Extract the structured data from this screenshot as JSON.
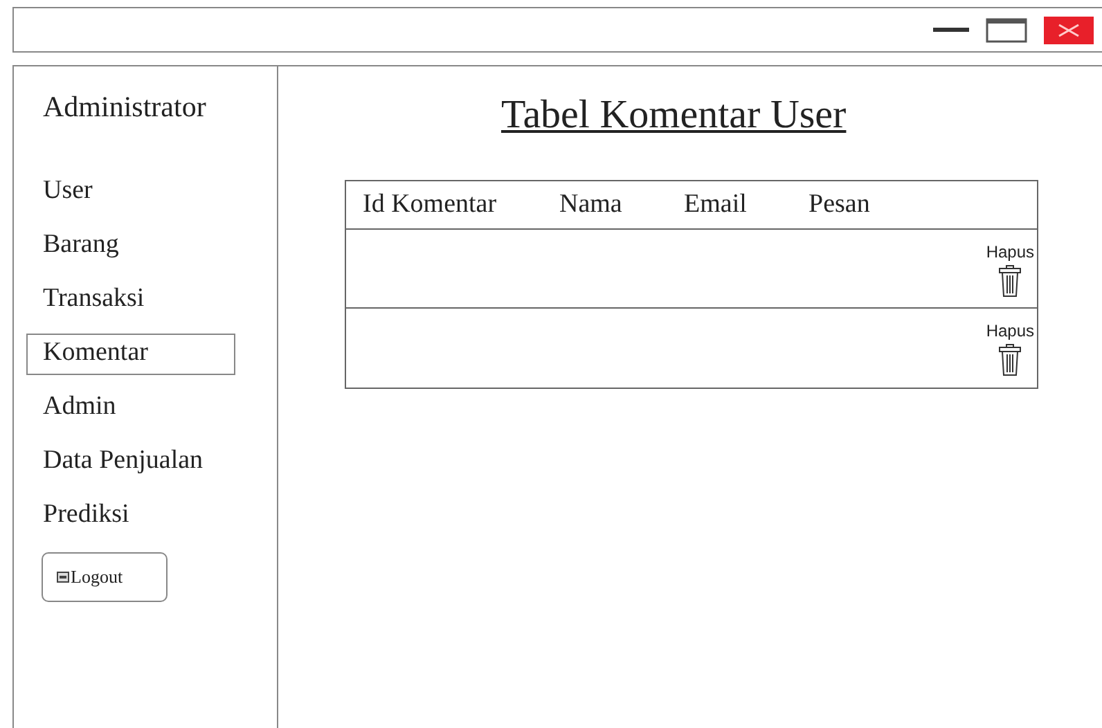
{
  "sidebar": {
    "title": "Administrator",
    "items": [
      {
        "label": "User",
        "selected": false
      },
      {
        "label": "Barang",
        "selected": false
      },
      {
        "label": "Transaksi",
        "selected": false
      },
      {
        "label": "Komentar",
        "selected": true
      },
      {
        "label": "Admin",
        "selected": false
      },
      {
        "label": "Data Penjualan",
        "selected": false
      },
      {
        "label": "Prediksi",
        "selected": false
      }
    ],
    "logout": "Logout"
  },
  "main": {
    "title": "Tabel Komentar User",
    "table": {
      "columns": [
        "Id Komentar",
        "Nama",
        "Email",
        "Pesan"
      ],
      "rows": [
        {
          "action": "Hapus"
        },
        {
          "action": "Hapus"
        }
      ]
    }
  }
}
